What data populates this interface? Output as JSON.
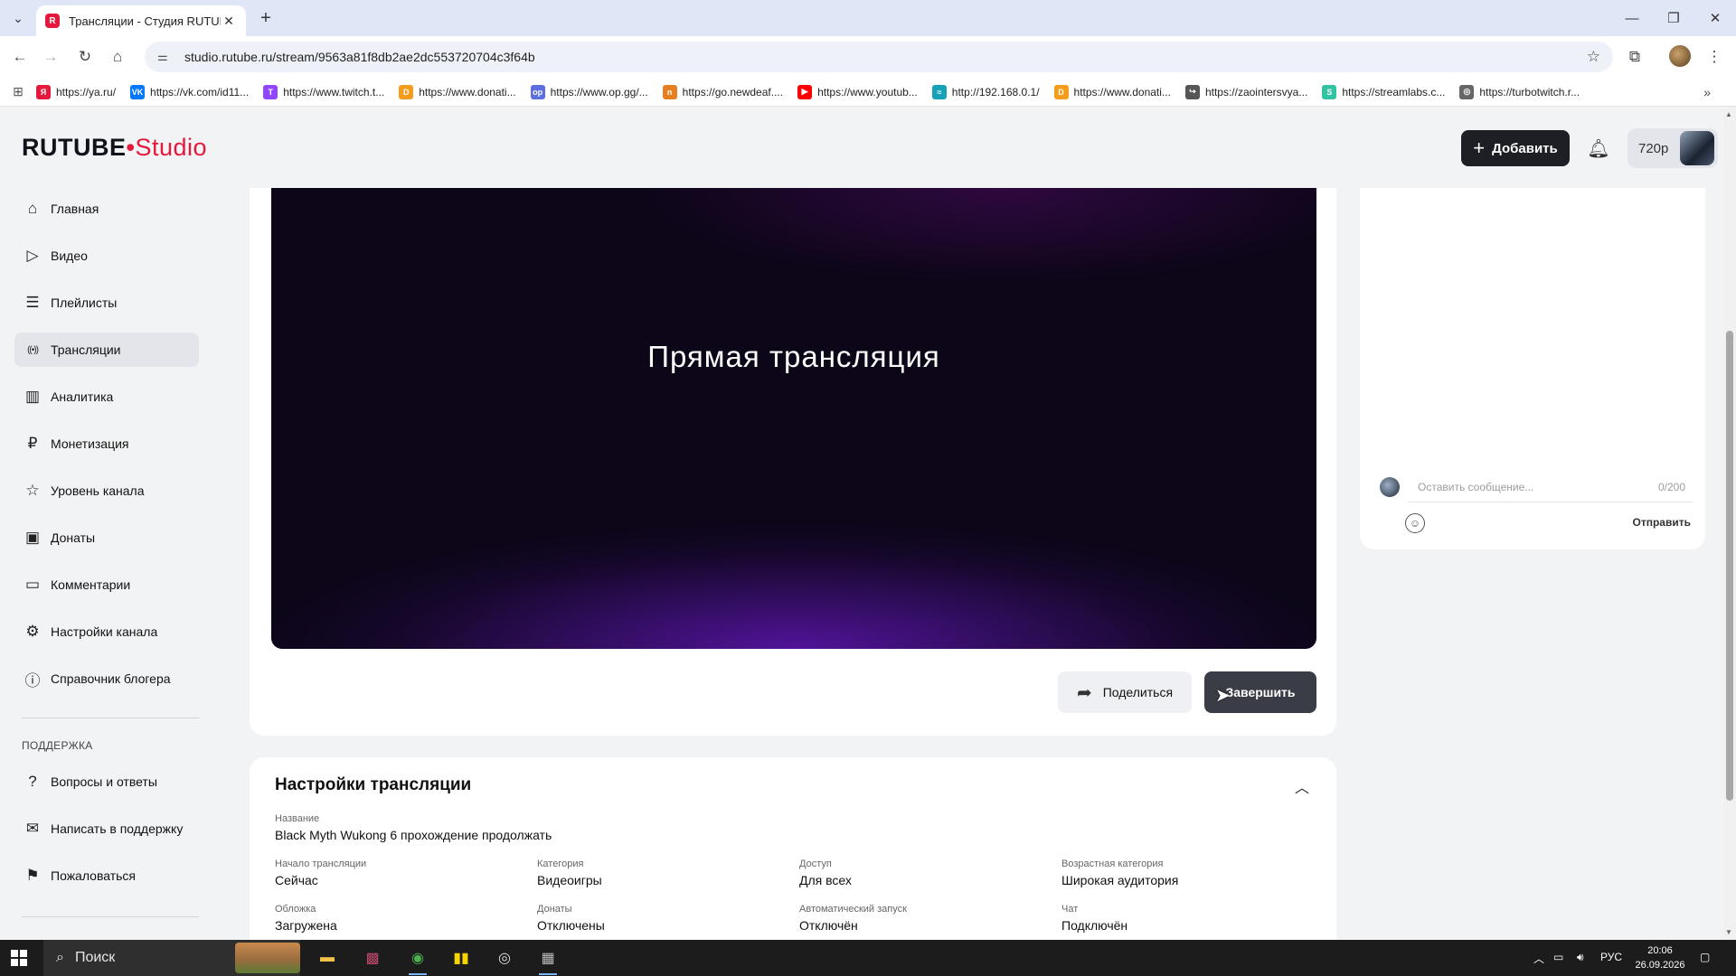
{
  "browser": {
    "tab_title": "Трансляции - Студия RUTUBE",
    "url": "studio.rutube.ru/stream/9563a81f8db2ae2dc553720704c3f64b",
    "bookmarks": [
      {
        "label": "https://ya.ru/",
        "color": "#e6183c",
        "glyph": "Я"
      },
      {
        "label": "https://vk.com/id11...",
        "color": "#0077ff",
        "glyph": "VK"
      },
      {
        "label": "https://www.twitch.t...",
        "color": "#9146ff",
        "glyph": "T"
      },
      {
        "label": "https://www.donati...",
        "color": "#f59c1a",
        "glyph": "D"
      },
      {
        "label": "https://www.op.gg/...",
        "color": "#5b6fe0",
        "glyph": "op"
      },
      {
        "label": "https://go.newdeaf....",
        "color": "#e67e22",
        "glyph": "n"
      },
      {
        "label": "https://www.youtub...",
        "color": "#ff0000",
        "glyph": "▶"
      },
      {
        "label": "http://192.168.0.1/",
        "color": "#17a2b8",
        "glyph": "≈"
      },
      {
        "label": "https://www.donati...",
        "color": "#f59c1a",
        "glyph": "D"
      },
      {
        "label": "https://zaointersvya...",
        "color": "#555555",
        "glyph": "↪"
      },
      {
        "label": "https://streamlabs.c...",
        "color": "#31c3a2",
        "glyph": "S"
      },
      {
        "label": "https://turbotwitch.r...",
        "color": "#666666",
        "glyph": "◎"
      }
    ]
  },
  "header": {
    "logo_main": "RUTUBE",
    "logo_studio": "Studio",
    "add_label": "Добавить",
    "quality": "720p"
  },
  "sidebar": {
    "items": [
      {
        "label": "Главная",
        "icon": "home-icon",
        "glyph": "⌂"
      },
      {
        "label": "Видео",
        "icon": "video-icon",
        "glyph": "▷"
      },
      {
        "label": "Плейлисты",
        "icon": "playlist-icon",
        "glyph": "☰"
      },
      {
        "label": "Трансляции",
        "icon": "broadcast-icon",
        "glyph": "((•))",
        "active": true
      },
      {
        "label": "Аналитика",
        "icon": "analytics-icon",
        "glyph": "▥"
      },
      {
        "label": "Монетизация",
        "icon": "monetization-icon",
        "glyph": "₽"
      },
      {
        "label": "Уровень канала",
        "icon": "star-icon",
        "glyph": "☆"
      },
      {
        "label": "Донаты",
        "icon": "wallet-icon",
        "glyph": "▣"
      },
      {
        "label": "Комментарии",
        "icon": "comment-icon",
        "glyph": "▭"
      },
      {
        "label": "Настройки канала",
        "icon": "gear-icon",
        "glyph": "⚙"
      },
      {
        "label": "Справочник блогера",
        "icon": "info-icon",
        "glyph": "ⓘ"
      }
    ],
    "support_heading": "ПОДДЕРЖКА",
    "support_items": [
      {
        "label": "Вопросы и ответы",
        "icon": "question-icon",
        "glyph": "?"
      },
      {
        "label": "Написать в поддержку",
        "icon": "mail-icon",
        "glyph": "✉"
      },
      {
        "label": "Пожаловаться",
        "icon": "flag-icon",
        "glyph": "⚑"
      }
    ]
  },
  "player": {
    "overlay_title": "Прямая трансляция",
    "share_label": "Поделиться",
    "finish_label": "Завершить"
  },
  "chat": {
    "placeholder": "Оставить сообщение...",
    "counter": "0/200",
    "send_label": "Отправить"
  },
  "settings": {
    "title": "Настройки трансляции",
    "name_label": "Название",
    "name_value": "Black Myth Wukong 6 прохождение продолжать",
    "fields": [
      {
        "label": "Начало трансляции",
        "value": "Сейчас"
      },
      {
        "label": "Категория",
        "value": "Видеоигры"
      },
      {
        "label": "Доступ",
        "value": "Для всех"
      },
      {
        "label": "Возрастная категория",
        "value": "Широкая аудитория"
      },
      {
        "label": "Обложка",
        "value": "Загружена"
      },
      {
        "label": "Донаты",
        "value": "Отключены"
      },
      {
        "label": "Автоматический запуск",
        "value": "Отключён"
      },
      {
        "label": "Чат",
        "value": "Подключён"
      }
    ]
  },
  "taskbar": {
    "search_label": "Поиск",
    "lang": "РУС",
    "time": "20:06",
    "date": "26.09.2026"
  }
}
